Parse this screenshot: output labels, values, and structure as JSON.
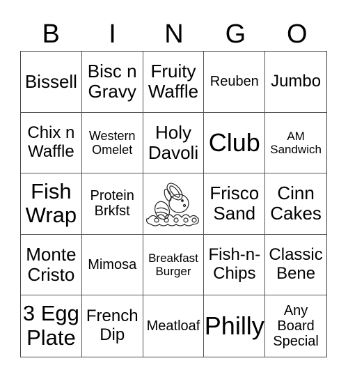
{
  "header": [
    "B",
    "I",
    "N",
    "G",
    "O"
  ],
  "cells": [
    [
      "Bissell",
      "Bisc n Gravy",
      "Fruity Waffle",
      "Reuben",
      "Jumbo"
    ],
    [
      "Chix n Waffle",
      "Western Omelet",
      "Holy Davoli",
      "Club",
      "AM Sandwich"
    ],
    [
      "Fish Wrap",
      "Protein Brkfst",
      "free-space-bunny-icon",
      "Frisco Sand",
      "Cinn Cakes"
    ],
    [
      "Monte Cristo",
      "Mimosa",
      "Breakfast Burger",
      "Fish-n-Chips",
      "Classic Bene"
    ],
    [
      "3 Egg Plate",
      "French Dip",
      "Meatloaf",
      "Philly",
      "Any Board Special"
    ]
  ],
  "lines": {
    "r0c1": [
      "Bisc n",
      "Gravy"
    ],
    "r0c2": [
      "Fruity",
      "Waffle"
    ],
    "r1c0": [
      "Chix n",
      "Waffle"
    ],
    "r1c1": [
      "Western",
      "Omelet"
    ],
    "r1c2": [
      "Holy",
      "Davoli"
    ],
    "r1c4": [
      "AM",
      "Sandwich"
    ],
    "r2c0": [
      "Fish",
      "Wrap"
    ],
    "r2c1": [
      "Protein",
      "Brkfst"
    ],
    "r2c3": [
      "Frisco",
      "Sand"
    ],
    "r2c4": [
      "Cinn",
      "Cakes"
    ],
    "r3c0": [
      "Monte",
      "Cristo"
    ],
    "r3c2": [
      "Breakfast",
      "Burger"
    ],
    "r3c3": [
      "Fish-n-",
      "Chips"
    ],
    "r3c4": [
      "Classic",
      "Bene"
    ],
    "r4c0": [
      "3 Egg",
      "Plate"
    ],
    "r4c1": [
      "French",
      "Dip"
    ],
    "r4c4": [
      "Any",
      "Board",
      "Special"
    ]
  }
}
